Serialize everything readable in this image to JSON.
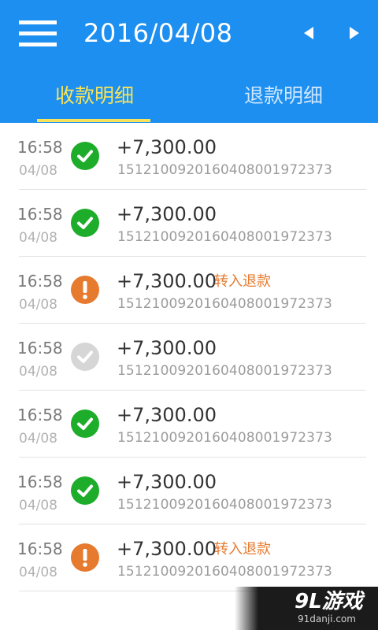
{
  "header": {
    "date": "2016/04/08",
    "menu_icon": "hamburger-menu-icon",
    "prev_icon": "triangle-left-icon",
    "next_icon": "triangle-right-icon",
    "background_color": "#1c8ff0"
  },
  "tabs": [
    {
      "label": "收款明细",
      "active": true,
      "color": "#f7e35a"
    },
    {
      "label": "退款明细",
      "active": false,
      "color": "#cfe7ff"
    }
  ],
  "records": [
    {
      "time": "16:58",
      "date": "04/08",
      "status": "success",
      "amount": "+7,300.00",
      "tag": "",
      "serial": "1512100920160408001972373"
    },
    {
      "time": "16:58",
      "date": "04/08",
      "status": "success",
      "amount": "+7,300.00",
      "tag": "",
      "serial": "1512100920160408001972373"
    },
    {
      "time": "16:58",
      "date": "04/08",
      "status": "warning",
      "amount": "+7,300.00",
      "tag": "转入退款",
      "serial": "1512100920160408001972373"
    },
    {
      "time": "16:58",
      "date": "04/08",
      "status": "disabled",
      "amount": "+7,300.00",
      "tag": "",
      "serial": "1512100920160408001972373"
    },
    {
      "time": "16:58",
      "date": "04/08",
      "status": "success",
      "amount": "+7,300.00",
      "tag": "",
      "serial": "1512100920160408001972373"
    },
    {
      "time": "16:58",
      "date": "04/08",
      "status": "success",
      "amount": "+7,300.00",
      "tag": "",
      "serial": "1512100920160408001972373"
    },
    {
      "time": "16:58",
      "date": "04/08",
      "status": "warning",
      "amount": "+7,300.00",
      "tag": "转入退款",
      "serial": "1512100920160408001972373"
    }
  ],
  "status_colors": {
    "success": "#1dad2a",
    "warning": "#e67a2e",
    "disabled": "#d6d6d6"
  },
  "watermark": {
    "logo": "9L游戏",
    "url": "91danji.com"
  }
}
